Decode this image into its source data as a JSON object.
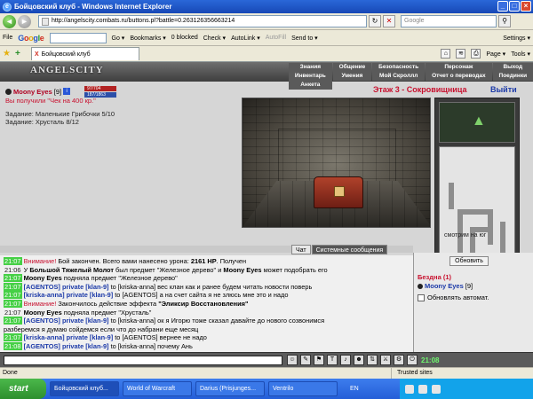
{
  "window": {
    "title": "Бойцовский клуб - Windows Internet Explorer",
    "min": "_",
    "max": "□",
    "close": "×"
  },
  "nav": {
    "back": "◄",
    "forward": "►",
    "refresh": "↻",
    "stop": "✕",
    "url": "http://angelscity.combats.ru/buttons.pl?battle=0.263126356663214",
    "search_placeholder": "Google",
    "search_go": "⚲"
  },
  "toolbar": {
    "file": "File",
    "go": "Go ▾",
    "bookmarks": "Bookmarks ▾",
    "blocked": "0 blocked",
    "check": "Check ▾",
    "autolink": "AutoLink ▾",
    "autofill": "AutoFill",
    "send_to": "Send to ▾",
    "settings": "Settings ▾"
  },
  "tabs": {
    "star": "★",
    "add": "+",
    "items": [
      {
        "label": "Бойцовский клуб",
        "close": "X"
      }
    ],
    "page": "Page ▾",
    "tools": "Tools ▾"
  },
  "game": {
    "logo": "ANGELSCITY",
    "menu": [
      "Знания",
      "Общение",
      "Безопасность",
      "Персонаж",
      "Выход",
      "Инвентарь",
      "Умения",
      "Мой Скроллл",
      "Отчет о переводах",
      "Поединки",
      "Анкета"
    ],
    "character": {
      "name": "Moony Eyes",
      "level": "[9]",
      "info": "i",
      "hp": "97/704",
      "mp": "187/1863",
      "received": "Вы получили \"Чек на 400 кр.\""
    },
    "tasks": [
      "Задание: Маленькие Грибочки 5/10",
      "Задание: Хрусталь 8/12"
    ],
    "location": "Этаж 3 - Сокровищница",
    "exit": "Выйти",
    "seen": "смотрим на юг",
    "chat_tabs": [
      "Чат",
      "Системные сообщения"
    ],
    "chat": [
      {
        "time": "21:07",
        "parts": [
          {
            "t": "Внимание!",
            "c": "red"
          },
          {
            "t": " Бой закончен. Всего вами нанесено урона: "
          },
          {
            "t": "2161 HP",
            "c": "bold"
          },
          {
            "t": ". Получен"
          }
        ]
      },
      {
        "time": "21:06",
        "plain": true,
        "parts": [
          {
            "t": "У "
          },
          {
            "t": "Большой Тяжелый Молот",
            "c": "bold"
          },
          {
            "t": " был предмет \"Железное дерево\" и "
          },
          {
            "t": "Moony Eyes",
            "c": "bold"
          },
          {
            "t": " может подобрать его"
          }
        ]
      },
      {
        "time": "21:07",
        "parts": [
          {
            "t": "Moony Eyes",
            "c": "bold"
          },
          {
            "t": " подняла предмет \"Железное дерево\""
          }
        ]
      },
      {
        "time": "21:07",
        "parts": [
          {
            "t": "[AGENTOS] private [klan-9]",
            "c": "nick"
          },
          {
            "t": " to [kriska-anna] вес клан как и ранее будем читать новости поверь"
          }
        ]
      },
      {
        "time": "21:07",
        "parts": [
          {
            "t": "[kriska-anna] private [klan-9]",
            "c": "nick"
          },
          {
            "t": " to [AGENTOS] а на счет сайта я не злюсь мне это и надо"
          }
        ]
      },
      {
        "time": "21:07",
        "parts": [
          {
            "t": "Внимание!",
            "c": "red"
          },
          {
            "t": " Закончилось действие эффекта "
          },
          {
            "t": "\"Эликсир Восстановления\"",
            "c": "bold"
          }
        ]
      },
      {
        "time": "21:07",
        "plain": true,
        "parts": [
          {
            "t": "Moony Eyes",
            "c": "bold"
          },
          {
            "t": " подняла предмет \"Хрусталь\""
          }
        ]
      },
      {
        "time": "21:07",
        "parts": [
          {
            "t": "[AGENTOS] private [klan-9]",
            "c": "nick"
          },
          {
            "t": " to [kriska-anna] ок я Игорю тоже сказал давайте до нового созвонимся"
          }
        ]
      },
      {
        "time": "",
        "plain": true,
        "parts": [
          {
            "t": "разберемся я думаю сойдемся если что до набрани еще месяц"
          }
        ]
      },
      {
        "time": "21:07",
        "parts": [
          {
            "t": "[kriska-anna] private [klan-9]",
            "c": "nick"
          },
          {
            "t": " to [AGENTOS] вернее не надо"
          }
        ]
      },
      {
        "time": "21:08",
        "parts": [
          {
            "t": "[AGENTOS] private [klan-9]",
            "c": "nick"
          },
          {
            "t": " to [kriska-anna] почему Ань"
          }
        ]
      }
    ],
    "room": {
      "refresh": "Обновить",
      "title": "Бездна (1)",
      "user": "Moony Eyes",
      "user_level": "[9]",
      "auto_refresh": "Обновлять автомат."
    },
    "clock": "21:08"
  },
  "status": {
    "left": "Done",
    "zone": "Trusted sites"
  },
  "taskbar": {
    "start": "start",
    "items": [
      "Бойцовский клуб...",
      "World of Warcraft",
      "Darius (Prisjunges...",
      "Ventrilo"
    ],
    "lang": "EN"
  }
}
